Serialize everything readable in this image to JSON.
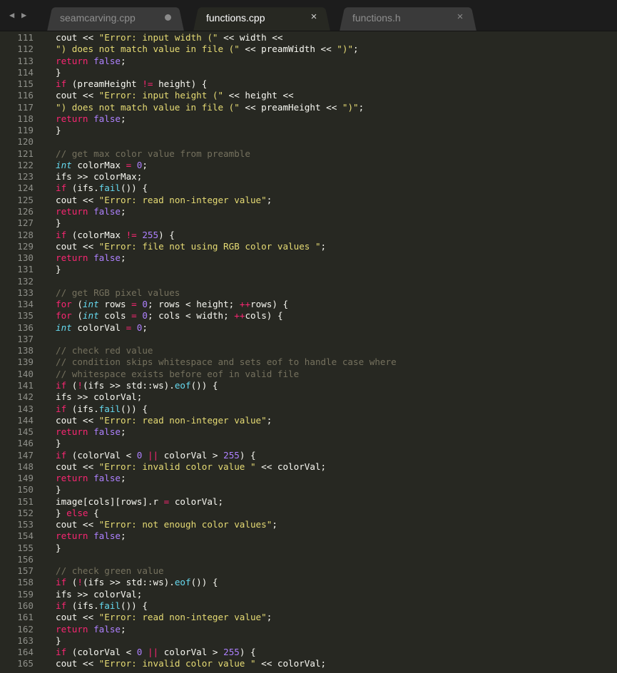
{
  "nav": {
    "back_glyph": "◀",
    "forward_glyph": "▶"
  },
  "tabs": [
    {
      "label": "seamcarving.cpp",
      "control": "dirty-dot",
      "active": false
    },
    {
      "label": "functions.cpp",
      "control": "×",
      "active": true
    },
    {
      "label": "functions.h",
      "control": "×",
      "active": false
    }
  ],
  "lines": [
    {
      "n": "111",
      "t": [
        [
          "cout << ",
          ""
        ],
        [
          "\"Error: input width (\"",
          "st"
        ],
        [
          " << width <<",
          ""
        ]
      ]
    },
    {
      "n": "112",
      "t": [
        [
          "\") does not match value in file (\"",
          "st"
        ],
        [
          " << preamWidth << ",
          ""
        ],
        [
          "\")\"",
          "st"
        ],
        [
          ";",
          ""
        ]
      ]
    },
    {
      "n": "113",
      "t": [
        [
          "return",
          "kw"
        ],
        [
          " ",
          ""
        ],
        [
          "false",
          "nm"
        ],
        [
          ";",
          ""
        ]
      ]
    },
    {
      "n": "114",
      "t": [
        [
          "}",
          ""
        ]
      ]
    },
    {
      "n": "115",
      "t": [
        [
          "if",
          "kw"
        ],
        [
          " (preamHeight ",
          ""
        ],
        [
          "!=",
          "kw"
        ],
        [
          " height) {",
          ""
        ]
      ]
    },
    {
      "n": "116",
      "t": [
        [
          "cout << ",
          ""
        ],
        [
          "\"Error: input height (\"",
          "st"
        ],
        [
          " << height <<",
          ""
        ]
      ]
    },
    {
      "n": "117",
      "t": [
        [
          "\") does not match value in file (\"",
          "st"
        ],
        [
          " << preamHeight << ",
          ""
        ],
        [
          "\")\"",
          "st"
        ],
        [
          ";",
          ""
        ]
      ]
    },
    {
      "n": "118",
      "t": [
        [
          "return",
          "kw"
        ],
        [
          " ",
          ""
        ],
        [
          "false",
          "nm"
        ],
        [
          ";",
          ""
        ]
      ]
    },
    {
      "n": "119",
      "t": [
        [
          "}",
          ""
        ]
      ]
    },
    {
      "n": "120",
      "t": []
    },
    {
      "n": "121",
      "t": [
        [
          "// get max color value from preamble",
          "co"
        ]
      ]
    },
    {
      "n": "122",
      "t": [
        [
          "int",
          "ty"
        ],
        [
          " colorMax ",
          ""
        ],
        [
          "=",
          "kw"
        ],
        [
          " ",
          ""
        ],
        [
          "0",
          "nm"
        ],
        [
          ";",
          ""
        ]
      ]
    },
    {
      "n": "123",
      "t": [
        [
          "ifs >> colorMax;",
          ""
        ]
      ]
    },
    {
      "n": "124",
      "t": [
        [
          "if",
          "kw"
        ],
        [
          " (ifs.",
          ""
        ],
        [
          "fail",
          "fn"
        ],
        [
          "()) {",
          ""
        ]
      ]
    },
    {
      "n": "125",
      "t": [
        [
          "cout << ",
          ""
        ],
        [
          "\"Error: read non-integer value\"",
          "st"
        ],
        [
          ";",
          ""
        ]
      ]
    },
    {
      "n": "126",
      "t": [
        [
          "return",
          "kw"
        ],
        [
          " ",
          ""
        ],
        [
          "false",
          "nm"
        ],
        [
          ";",
          ""
        ]
      ]
    },
    {
      "n": "127",
      "t": [
        [
          "}",
          ""
        ]
      ]
    },
    {
      "n": "128",
      "t": [
        [
          "if",
          "kw"
        ],
        [
          " (colorMax ",
          ""
        ],
        [
          "!=",
          "kw"
        ],
        [
          " ",
          ""
        ],
        [
          "255",
          "nm"
        ],
        [
          ") {",
          ""
        ]
      ]
    },
    {
      "n": "129",
      "t": [
        [
          "cout << ",
          ""
        ],
        [
          "\"Error: file not using RGB color values \"",
          "st"
        ],
        [
          ";",
          ""
        ]
      ]
    },
    {
      "n": "130",
      "t": [
        [
          "return",
          "kw"
        ],
        [
          " ",
          ""
        ],
        [
          "false",
          "nm"
        ],
        [
          ";",
          ""
        ]
      ]
    },
    {
      "n": "131",
      "t": [
        [
          "}",
          ""
        ]
      ]
    },
    {
      "n": "132",
      "t": []
    },
    {
      "n": "133",
      "t": [
        [
          "// get RGB pixel values",
          "co"
        ]
      ]
    },
    {
      "n": "134",
      "t": [
        [
          "for",
          "kw"
        ],
        [
          " (",
          ""
        ],
        [
          "int",
          "ty"
        ],
        [
          " rows ",
          ""
        ],
        [
          "=",
          "kw"
        ],
        [
          " ",
          ""
        ],
        [
          "0",
          "nm"
        ],
        [
          "; rows < height; ",
          ""
        ],
        [
          "++",
          "kw"
        ],
        [
          "rows) {",
          ""
        ]
      ]
    },
    {
      "n": "135",
      "t": [
        [
          "for",
          "kw"
        ],
        [
          " (",
          ""
        ],
        [
          "int",
          "ty"
        ],
        [
          " cols ",
          ""
        ],
        [
          "=",
          "kw"
        ],
        [
          " ",
          ""
        ],
        [
          "0",
          "nm"
        ],
        [
          "; cols < width; ",
          ""
        ],
        [
          "++",
          "kw"
        ],
        [
          "cols) {",
          ""
        ]
      ]
    },
    {
      "n": "136",
      "t": [
        [
          "int",
          "ty"
        ],
        [
          " colorVal ",
          ""
        ],
        [
          "=",
          "kw"
        ],
        [
          " ",
          ""
        ],
        [
          "0",
          "nm"
        ],
        [
          ";",
          ""
        ]
      ]
    },
    {
      "n": "137",
      "t": []
    },
    {
      "n": "138",
      "t": [
        [
          "// check red value",
          "co"
        ]
      ]
    },
    {
      "n": "139",
      "t": [
        [
          "// condition skips whitespace and sets eof to handle case where",
          "co"
        ]
      ]
    },
    {
      "n": "140",
      "t": [
        [
          "// whitespace exists before eof in valid file",
          "co"
        ]
      ]
    },
    {
      "n": "141",
      "t": [
        [
          "if",
          "kw"
        ],
        [
          " (",
          ""
        ],
        [
          "!",
          "kw"
        ],
        [
          "(ifs >> std::ws).",
          ""
        ],
        [
          "eof",
          "fn"
        ],
        [
          "()) {",
          ""
        ]
      ]
    },
    {
      "n": "142",
      "t": [
        [
          "ifs >> colorVal;",
          ""
        ]
      ]
    },
    {
      "n": "143",
      "t": [
        [
          "if",
          "kw"
        ],
        [
          " (ifs.",
          ""
        ],
        [
          "fail",
          "fn"
        ],
        [
          "()) {",
          ""
        ]
      ]
    },
    {
      "n": "144",
      "t": [
        [
          "cout << ",
          ""
        ],
        [
          "\"Error: read non-integer value\"",
          "st"
        ],
        [
          ";",
          ""
        ]
      ]
    },
    {
      "n": "145",
      "t": [
        [
          "return",
          "kw"
        ],
        [
          " ",
          ""
        ],
        [
          "false",
          "nm"
        ],
        [
          ";",
          ""
        ]
      ]
    },
    {
      "n": "146",
      "t": [
        [
          "}",
          ""
        ]
      ]
    },
    {
      "n": "147",
      "t": [
        [
          "if",
          "kw"
        ],
        [
          " (colorVal < ",
          ""
        ],
        [
          "0",
          "nm"
        ],
        [
          " ",
          ""
        ],
        [
          "||",
          "kw"
        ],
        [
          " colorVal > ",
          ""
        ],
        [
          "255",
          "nm"
        ],
        [
          ") {",
          ""
        ]
      ]
    },
    {
      "n": "148",
      "t": [
        [
          "cout << ",
          ""
        ],
        [
          "\"Error: invalid color value \"",
          "st"
        ],
        [
          " << colorVal;",
          ""
        ]
      ]
    },
    {
      "n": "149",
      "t": [
        [
          "return",
          "kw"
        ],
        [
          " ",
          ""
        ],
        [
          "false",
          "nm"
        ],
        [
          ";",
          ""
        ]
      ]
    },
    {
      "n": "150",
      "t": [
        [
          "}",
          ""
        ]
      ]
    },
    {
      "n": "151",
      "t": [
        [
          "image[cols][rows].r ",
          ""
        ],
        [
          "=",
          "kw"
        ],
        [
          " colorVal;",
          ""
        ]
      ]
    },
    {
      "n": "152",
      "t": [
        [
          "} ",
          ""
        ],
        [
          "else",
          "kw"
        ],
        [
          " {",
          ""
        ]
      ]
    },
    {
      "n": "153",
      "t": [
        [
          "cout << ",
          ""
        ],
        [
          "\"Error: not enough color values\"",
          "st"
        ],
        [
          ";",
          ""
        ]
      ]
    },
    {
      "n": "154",
      "t": [
        [
          "return",
          "kw"
        ],
        [
          " ",
          ""
        ],
        [
          "false",
          "nm"
        ],
        [
          ";",
          ""
        ]
      ]
    },
    {
      "n": "155",
      "t": [
        [
          "}",
          ""
        ]
      ]
    },
    {
      "n": "156",
      "t": []
    },
    {
      "n": "157",
      "t": [
        [
          "// check green value",
          "co"
        ]
      ]
    },
    {
      "n": "158",
      "t": [
        [
          "if",
          "kw"
        ],
        [
          " (",
          ""
        ],
        [
          "!",
          "kw"
        ],
        [
          "(ifs >> std::ws).",
          ""
        ],
        [
          "eof",
          "fn"
        ],
        [
          "()) {",
          ""
        ]
      ]
    },
    {
      "n": "159",
      "t": [
        [
          "ifs >> colorVal;",
          ""
        ]
      ]
    },
    {
      "n": "160",
      "t": [
        [
          "if",
          "kw"
        ],
        [
          " (ifs.",
          ""
        ],
        [
          "fail",
          "fn"
        ],
        [
          "()) {",
          ""
        ]
      ]
    },
    {
      "n": "161",
      "t": [
        [
          "cout << ",
          ""
        ],
        [
          "\"Error: read non-integer value\"",
          "st"
        ],
        [
          ";",
          ""
        ]
      ]
    },
    {
      "n": "162",
      "t": [
        [
          "return",
          "kw"
        ],
        [
          " ",
          ""
        ],
        [
          "false",
          "nm"
        ],
        [
          ";",
          ""
        ]
      ]
    },
    {
      "n": "163",
      "t": [
        [
          "}",
          ""
        ]
      ]
    },
    {
      "n": "164",
      "t": [
        [
          "if",
          "kw"
        ],
        [
          " (colorVal < ",
          ""
        ],
        [
          "0",
          "nm"
        ],
        [
          " ",
          ""
        ],
        [
          "||",
          "kw"
        ],
        [
          " colorVal > ",
          ""
        ],
        [
          "255",
          "nm"
        ],
        [
          ") {",
          ""
        ]
      ]
    },
    {
      "n": "165",
      "t": [
        [
          "cout << ",
          ""
        ],
        [
          "\"Error: invalid color value \"",
          "st"
        ],
        [
          " << colorVal;",
          ""
        ]
      ]
    }
  ]
}
